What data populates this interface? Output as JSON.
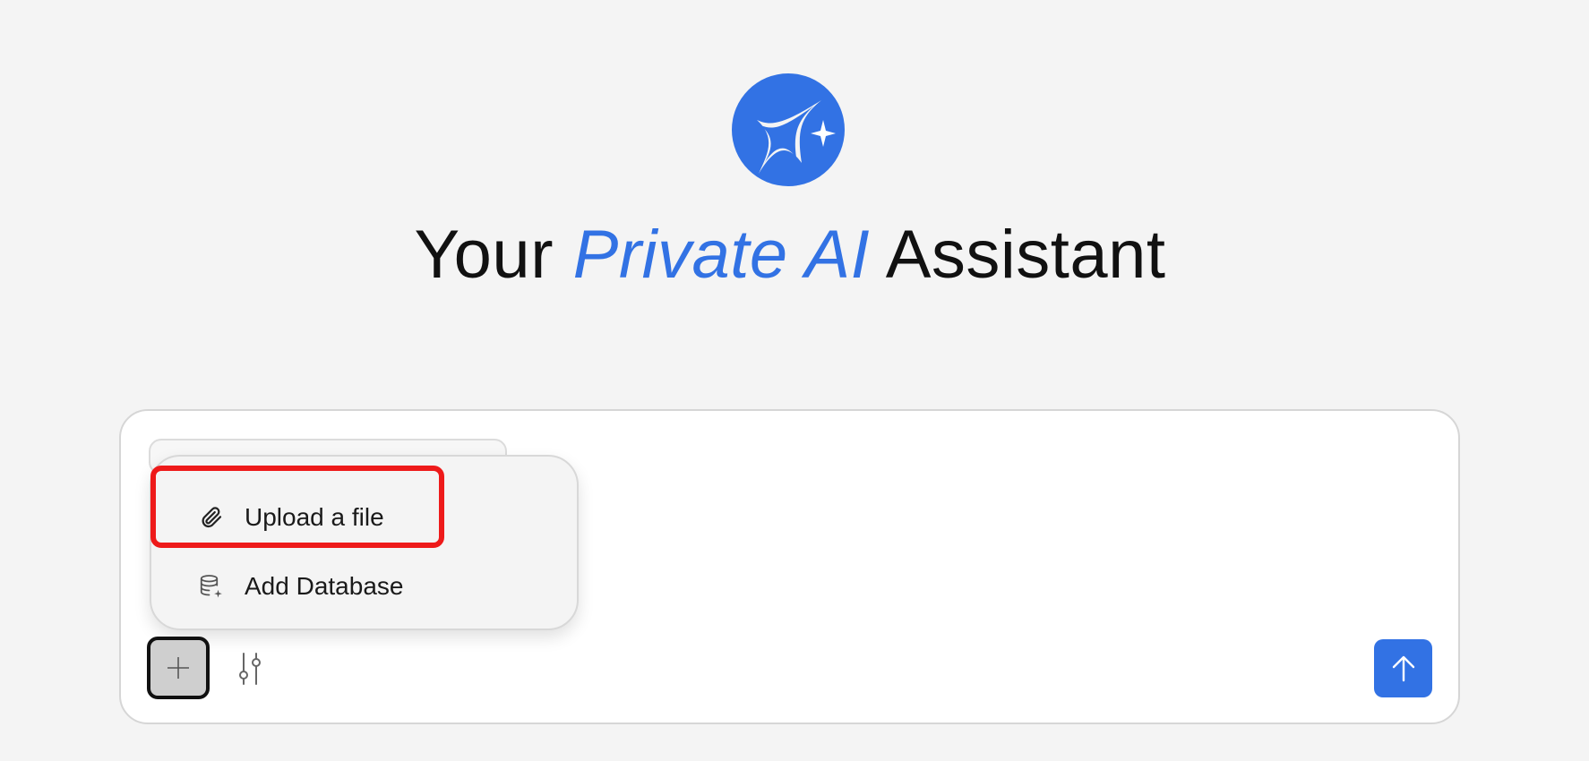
{
  "headline": {
    "prefix": "Your ",
    "accent": "Private AI",
    "suffix": " Assistant"
  },
  "menu": {
    "items": [
      {
        "label": "Upload a file",
        "icon": "paperclip-icon"
      },
      {
        "label": "Add Database",
        "icon": "database-add-icon"
      }
    ]
  },
  "toolbar": {
    "attach_icon": "plus-icon",
    "settings_icon": "sliders-icon",
    "send_icon": "arrow-up-icon"
  },
  "colors": {
    "accent": "#3272e4",
    "background": "#f4f4f4",
    "highlight": "#ee1a1a"
  }
}
